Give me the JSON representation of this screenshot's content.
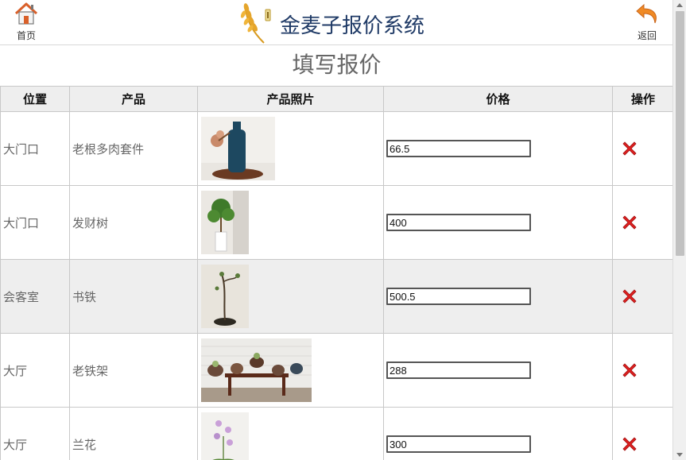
{
  "header": {
    "home_label": "首页",
    "title": "金麦子报价系统",
    "back_label": "返回"
  },
  "page_title": "填写报价",
  "table": {
    "columns": [
      "位置",
      "产品",
      "产品照片",
      "价格",
      "操作"
    ],
    "rows": [
      {
        "location": "大门口",
        "product": "老根多肉套件",
        "price": "66.5",
        "photo": "vase-succulent"
      },
      {
        "location": "大门口",
        "product": "发财树",
        "price": "400",
        "photo": "money-tree"
      },
      {
        "location": "会客室",
        "product": "书铁",
        "price": "500.5",
        "photo": "bonsai-stand"
      },
      {
        "location": "大厅",
        "product": "老铁架",
        "price": "288",
        "photo": "iron-rack"
      },
      {
        "location": "大厅",
        "product": "兰花",
        "price": "300",
        "photo": "orchid"
      }
    ]
  },
  "colors": {
    "title_blue": "#1f3a66",
    "delete_red": "#e02020",
    "header_bg": "#eeeeee",
    "home_orange": "#e0632a"
  }
}
